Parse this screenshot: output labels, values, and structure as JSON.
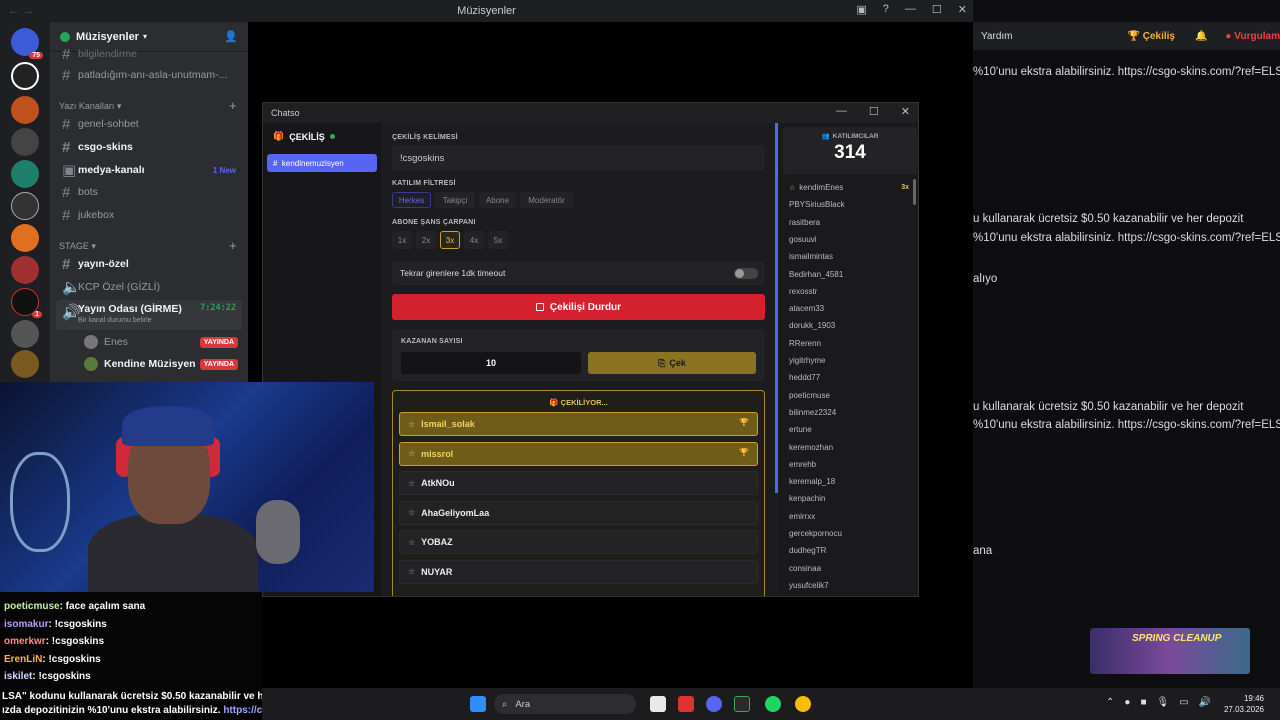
{
  "discord": {
    "window_title": "Müzisyenler",
    "guild_name": "Müzisyenler",
    "server_badge": "75",
    "server_badge_2": "1",
    "channels": {
      "partial_top": "bilgilendirme",
      "patladigim": "patladığım-anı-asla-unutmam-...",
      "text_category": "Yazı Kanalları",
      "genel": "genel-sohbet",
      "csgo": "csgo-skins",
      "medya": "medya-kanalı",
      "medya_new": "1 New",
      "bots": "bots",
      "jukebox": "jukebox",
      "stage_category": "STAGE",
      "yayin_ozel": "yayın-özel",
      "kcp": "KCP Özel (GİZLİ)",
      "yayin_odasi": "Yayın Odası (GİRME)",
      "yayin_odasi_time": "7:24:22",
      "status_placeholder": "Bir kanal durumu belirle",
      "member_1": "Enes",
      "member_2": "Kendine Müzisyen",
      "live_label_1": "YAYINDA",
      "live_label_2": "YAYINDA"
    },
    "right_panel": {
      "help": "Yardım",
      "giveaway": "Çekiliş",
      "emphasis": "Vurgulam",
      "lines": [
        "%10'unu ekstra alabilirsiniz. https://csgo-skins.com/?ref=ELS",
        "u kullanarak ücretsiz $0.50 kazanabilir ve her depozit",
        "%10'unu ekstra alabilirsiniz. https://csgo-skins.com/?ref=ELS",
        "alıyo",
        "u kullanarak ücretsiz $0.50 kazanabilir ve her depozit",
        "%10'unu ekstra alabilirsiniz. https://csgo-skins.com/?ref=ELS",
        "ana"
      ]
    }
  },
  "chatso": {
    "window_title": "Chatso",
    "nav": {
      "section": "ÇEKİLİŞ",
      "channel": "kendinemuzisyen"
    },
    "keyword": {
      "label": "ÇEKİLİŞ KELİMESİ",
      "value": "!csgoskins"
    },
    "filter": {
      "label": "KATILIM FİLTRESİ",
      "options": [
        "Herkes",
        "Takipçi",
        "Abone",
        "Moderatör"
      ],
      "selected": "Herkes"
    },
    "multiplier": {
      "label": "ABONE ŞANS ÇARPANI",
      "options": [
        "1x",
        "2x",
        "3x",
        "4x",
        "5x"
      ],
      "selected": "3x"
    },
    "timeout_label": "Tekrar girenlere 1dk timeout",
    "timeout_enabled": false,
    "stop_label": "Çekilişi Durdur",
    "winner_count_label": "KAZANAN SAYISI",
    "winner_count": "10",
    "draw_label": "Çek",
    "drawing_title": "ÇEKİLİYOR...",
    "entries": [
      {
        "name": "Ismail_solak",
        "winner": true
      },
      {
        "name": "missrol",
        "winner": true
      },
      {
        "name": "AtkNOu",
        "winner": false
      },
      {
        "name": "AhaGeliyomLaa",
        "winner": false
      },
      {
        "name": "YOBAZ",
        "winner": false
      },
      {
        "name": "NUYAR",
        "winner": false
      }
    ],
    "participants": {
      "label": "KATILIMCILAR",
      "count": "314",
      "first_mult": "3x",
      "names": [
        "kendimEnes",
        "PBYSiriusBlack",
        "rasitbera",
        "gosuuvi",
        "ismailmintas",
        "Bedirhan_4581",
        "rexosstr",
        "atacem33",
        "dorukk_1903",
        "RRerenn",
        "yigitrhyme",
        "heddd77",
        "poeticmuse",
        "bilinmez2324",
        "ertune",
        "keremozhan",
        "emrehb",
        "keremalp_18",
        "kenpachin",
        "emirrxx",
        "gercekpornocu",
        "dudhegTR",
        "consinaa",
        "yusufcelik7"
      ]
    }
  },
  "stream_chat": [
    {
      "user": "poeticmuse",
      "color": "#c6f0a8",
      "text": ": face açalım sana"
    },
    {
      "user": "isomakur",
      "color": "#b79cff",
      "text": ": !csgoskins"
    },
    {
      "user": "omerkwr",
      "color": "#ff8c8c",
      "text": ": !csgoskins"
    },
    {
      "user": "ErenLiN",
      "color": "#ffb347",
      "text": ": !csgoskins"
    },
    {
      "user": "iskilet",
      "color": "#cfd6ff",
      "text": ": !csgoskins"
    }
  ],
  "promo": {
    "line1": "LSA\" kodunu kullanarak ücretsiz $0.50 kazanabilir ve her",
    "line2_text": "ızda depozitinizin %10'unu ekstra alabilirsiniz. ",
    "line2_link": "https://csgo-"
  },
  "taskbar": {
    "search_placeholder": "Ara",
    "time": "19:46",
    "date": "27.03.2026"
  },
  "overlay": {
    "spring_title": "SPRING CLEANUP"
  },
  "colors": {
    "discord_blurple": "#5865f2",
    "stop_red": "#d5202e",
    "winner_gold": "#c7a32c",
    "live_red": "#da373c"
  }
}
